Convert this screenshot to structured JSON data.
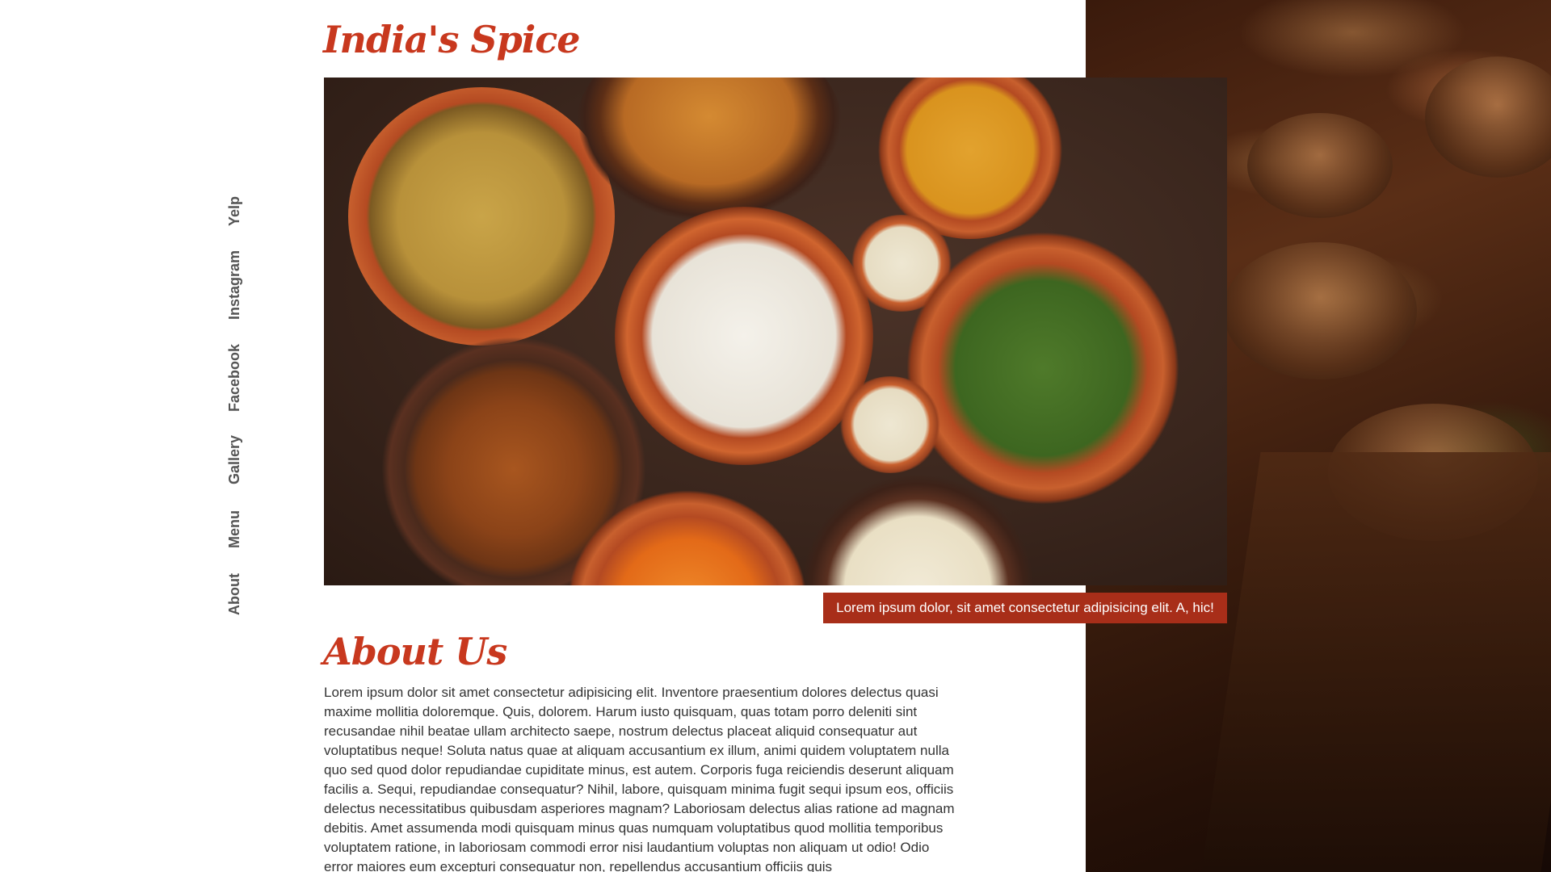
{
  "brand": {
    "title": "India's Spice"
  },
  "nav": {
    "items": [
      {
        "label": "Yelp"
      },
      {
        "label": "Instagram"
      },
      {
        "label": "Facebook"
      },
      {
        "label": "Gallery"
      },
      {
        "label": "Menu"
      },
      {
        "label": "About"
      }
    ]
  },
  "hero": {
    "caption": "Lorem ipsum dolor, sit amet consectetur adipisicing elit. A, hic!"
  },
  "about": {
    "title": "About Us",
    "body": "Lorem ipsum dolor sit amet consectetur adipisicing elit. Inventore praesentium dolores delectus quasi maxime mollitia doloremque. Quis, dolorem. Harum iusto quisquam, quas totam porro deleniti sint recusandae nihil beatae ullam architecto saepe, nostrum delectus placeat aliquid consequatur aut voluptatibus neque! Soluta natus quae at aliquam accusantium ex illum, animi quidem voluptatem nulla quo sed quod dolor repudiandae cupiditate minus, est autem. Corporis fuga reiciendis deserunt aliquam facilis a. Sequi, repudiandae consequatur? Nihil, labore, quisquam minima fugit sequi ipsum eos, officiis delectus necessitatibus quibusdam asperiores magnam? Laboriosam delectus alias ratione ad magnam debitis. Amet assumenda modi quisquam minus quas numquam voluptatibus quod mollitia temporibus voluptatem ratione, in laboriosam commodi error nisi laudantium voluptas non aliquam ut odio! Odio error maiores eum excepturi consequatur non, repellendus accusantium officiis quis"
  },
  "colors": {
    "accent": "#c8381e",
    "caption_bg": "#a82e19"
  }
}
